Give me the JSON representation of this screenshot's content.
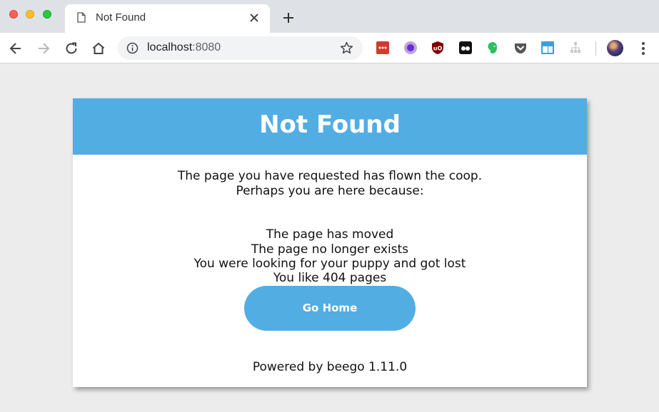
{
  "browser": {
    "tab": {
      "title": "Not Found"
    },
    "url": {
      "host": "localhost",
      "port": ":8080"
    },
    "extensions": [
      "todoist-icon",
      "purple-circle-icon",
      "ublock-icon",
      "tracker-icon",
      "evernote-icon",
      "pocket-icon",
      "window-icon",
      "sitemap-icon"
    ]
  },
  "page": {
    "title": "Not Found",
    "intro_line1": "The page you have requested has flown the coop.",
    "intro_line2": "Perhaps you are here because:",
    "reasons": [
      "The page has moved",
      "The page no longer exists",
      "You were looking for your puppy and got lost",
      "You like 404 pages"
    ],
    "button_label": "Go Home",
    "footer": "Powered by beego 1.11.0"
  },
  "colors": {
    "accent": "#52ade3",
    "chrome_frame": "#dee1e6"
  }
}
